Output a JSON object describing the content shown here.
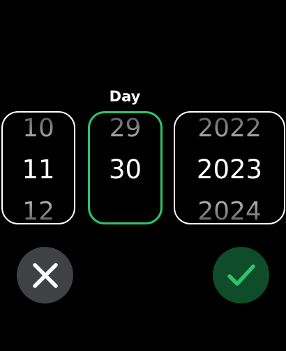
{
  "picker": {
    "title": "Day",
    "month": {
      "previous": "10",
      "current": "11",
      "next": "12"
    },
    "day": {
      "previous": "29",
      "current": "30",
      "next": ""
    },
    "year": {
      "previous": "2022",
      "current": "2023",
      "next": "2024"
    }
  },
  "actions": {
    "cancel_icon": "close-icon",
    "confirm_icon": "checkmark-icon"
  },
  "colors": {
    "background": "#000000",
    "selected_border": "#2ec46b",
    "wheel_border": "#ffffff",
    "cancel_button": "#3f4145",
    "confirm_button": "#0f4d2a",
    "checkmark": "#2ec46b"
  }
}
